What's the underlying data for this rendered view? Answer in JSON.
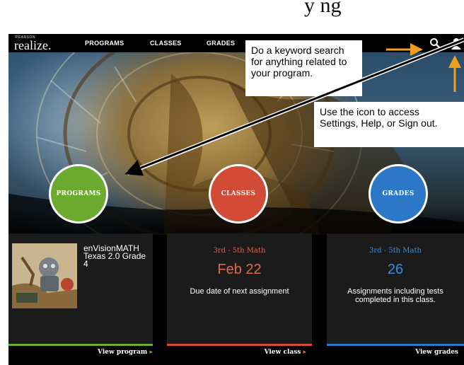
{
  "fragment_text": "y     ng",
  "nav": {
    "logo_small": "PEARSON",
    "logo_main": "realize.",
    "items": [
      "PROGRAMS",
      "CLASSES",
      "GRADES"
    ],
    "search_icon": "search-icon",
    "user_icon": "user-icon"
  },
  "callouts": {
    "search": "Do a keyword search for anything related to your program.",
    "user": "Use the icon to access Settings, Help, or Sign out."
  },
  "circles": {
    "programs": "PROGRAMS",
    "classes": "CLASSES",
    "grades": "GRADES"
  },
  "cards": {
    "program": {
      "title": "enVisionMATH Texas 2.0 Grade 4",
      "link": "View program"
    },
    "class": {
      "subtitle": "3rd - 5th Math",
      "value": "Feb 22",
      "desc": "Due date of next assignment",
      "link": "View class"
    },
    "grades": {
      "subtitle": "3rd - 5th Math",
      "value": "26",
      "desc": "Assignments including tests completed in this class.",
      "link": "View grades"
    }
  },
  "colors": {
    "programs": "#6aab2f",
    "classes": "#d14b36",
    "grades": "#2c78c7",
    "callout_arrow": "#f0a020"
  }
}
